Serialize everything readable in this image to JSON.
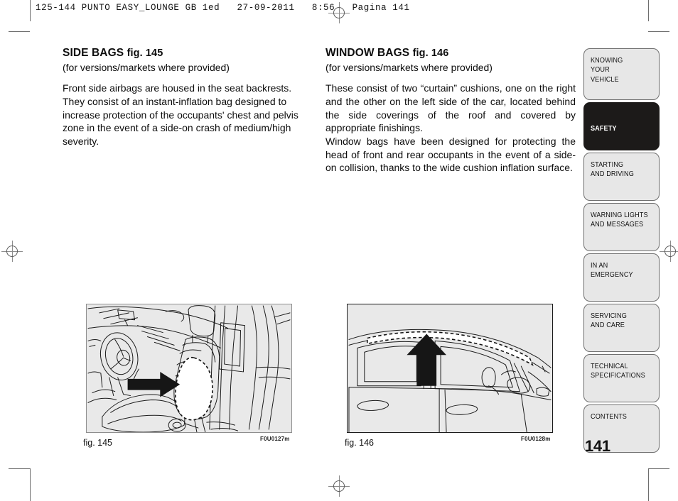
{
  "print_header": "125-144 PUNTO EASY_LOUNGE GB 1ed   27-09-2011   8:56   Pagina 141",
  "page_number": "141",
  "columns": {
    "left": {
      "title": "SIDE BAGS",
      "title_fig": "fig. 145",
      "subtitle": "(for versions/markets where provided)",
      "paragraphs": [
        "Front side airbags are housed in the seat backrests. They consist of an instant-inflation bag designed to increase protection of the occupants' chest and pelvis zone in the event of a side-on crash of medium/high severity."
      ]
    },
    "right": {
      "title": "WINDOW BAGS",
      "title_fig": "fig. 146",
      "subtitle": "(for versions/markets where provided)",
      "paragraphs": [
        "These consist of two “curtain” cushions, one on the right and the other on the left side of the car, located behind the side coverings of the roof and covered by appropriate finishings.",
        "Window bags have been designed for protecting the head of front and rear occupants in the event of a side-on collision, thanks to the wide cushion inflation surface."
      ]
    }
  },
  "figures": {
    "left": {
      "caption": "fig. 145",
      "code": "F0U0127m",
      "description": "Car interior view showing front seat backrest with dashed outline of side airbag and black arrow pointing right"
    },
    "right": {
      "caption": "fig. 146",
      "code": "F0U0128m",
      "description": "Car side exterior view showing dashed outline of window curtain bag along roof line with black arrow pointing up"
    }
  },
  "sidebar": {
    "tabs": [
      {
        "lines": [
          "KNOWING",
          "YOUR",
          "VEHICLE"
        ],
        "active": false,
        "height_class": "tab-h3"
      },
      {
        "lines": [
          "SAFETY"
        ],
        "active": true,
        "height_class": "tab-h1"
      },
      {
        "lines": [
          "STARTING",
          "AND DRIVING"
        ],
        "active": false,
        "height_class": "tab-h2"
      },
      {
        "lines": [
          "WARNING LIGHTS",
          "AND MESSAGES"
        ],
        "active": false,
        "height_class": "tab-h2"
      },
      {
        "lines": [
          "IN AN",
          "EMERGENCY"
        ],
        "active": false,
        "height_class": "tab-h2"
      },
      {
        "lines": [
          "SERVICING",
          "AND CARE"
        ],
        "active": false,
        "height_class": "tab-h2"
      },
      {
        "lines": [
          "TECHNICAL",
          "SPECIFICATIONS"
        ],
        "active": false,
        "height_class": "tab-h2"
      },
      {
        "lines": [
          "CONTENTS"
        ],
        "active": false,
        "height_class": "tab-h2"
      }
    ]
  },
  "colors": {
    "figure_background": "#e9e9e9",
    "tab_background": "#e7e7e7",
    "tab_active_background": "#1c1a19",
    "ink": "#0d0d0d",
    "trim_mark": "#6e6e6e"
  }
}
